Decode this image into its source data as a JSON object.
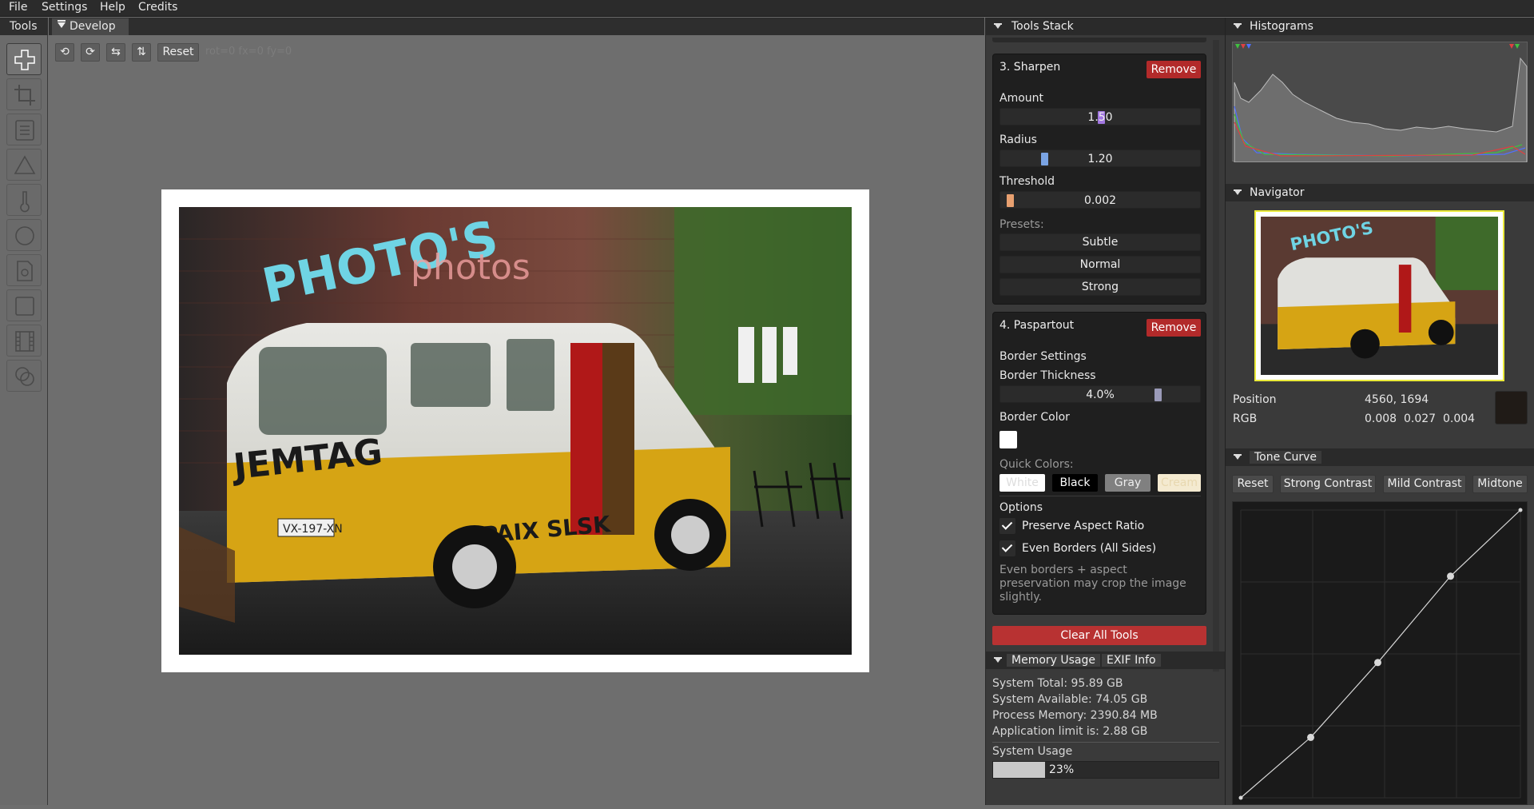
{
  "menu": {
    "file": "File",
    "settings": "Settings",
    "help": "Help",
    "credits": "Credits"
  },
  "tools_panel": {
    "title": "Tools",
    "icons": [
      "move-icon",
      "crop-icon",
      "list-icon",
      "triangle-icon",
      "thermometer-icon",
      "circle-icon",
      "document-icon",
      "square-icon",
      "film-icon",
      "overlap-circles-icon"
    ]
  },
  "develop": {
    "tab": "Develop",
    "buttons": {
      "rotate_left": "⟲",
      "rotate_right": "⟳",
      "flip_h": "⇆",
      "flip_v": "⇅",
      "reset": "Reset"
    },
    "readout": "rot=0 fx=0 fy=0"
  },
  "tools_stack": {
    "title": "Tools Stack",
    "sharpen": {
      "title": "3. Sharpen",
      "remove": "Remove",
      "amount_label": "Amount",
      "amount_value": "1.50",
      "amount_fraction": 0.5,
      "radius_label": "Radius",
      "radius_value": "1.20",
      "radius_fraction": 0.2,
      "threshold_label": "Threshold",
      "threshold_value": "0.002",
      "threshold_fraction": 0.02,
      "presets_label": "Presets:",
      "presets": [
        "Subtle",
        "Normal",
        "Strong"
      ]
    },
    "paspartout": {
      "title": "4. Paspartout",
      "remove": "Remove",
      "border_settings": "Border Settings",
      "thickness_label": "Border Thickness",
      "thickness_value": "4.0%",
      "thickness_fraction": 0.8,
      "color_label": "Border Color",
      "border_color": "#ffffff",
      "quick_colors_label": "Quick Colors:",
      "quick_colors": [
        {
          "label": "White",
          "bg": "#ffffff",
          "fg": "#dddddd"
        },
        {
          "label": "Black",
          "bg": "#000000",
          "fg": "#ffffff"
        },
        {
          "label": "Gray",
          "bg": "#808080",
          "fg": "#eeeeee"
        },
        {
          "label": "Cream",
          "bg": "#f4ead0",
          "fg": "#e8d8b0"
        }
      ],
      "options_label": "Options",
      "preserve_aspect": "Preserve Aspect Ratio",
      "even_borders": "Even Borders (All Sides)",
      "note": "Even borders + aspect preservation may crop the image slightly."
    },
    "clear_all": "Clear All Tools"
  },
  "memory": {
    "tab_memory": "Memory Usage",
    "tab_exif": "EXIF Info",
    "system_total": "System Total: 95.89 GB",
    "system_available": "System Available: 74.05 GB",
    "process_memory": "Process Memory: 2390.84 MB",
    "app_limit": "Application limit is: 2.88 GB",
    "usage_label": "System Usage",
    "usage_text": "23%",
    "usage_fraction": 0.23
  },
  "histograms": {
    "title": "Histograms"
  },
  "navigator": {
    "title": "Navigator",
    "position_label": "Position",
    "position_value": "4560, 1694",
    "rgb_label": "RGB",
    "rgb_value": "0.008  0.027  0.004"
  },
  "tone_curve": {
    "title": "Tone Curve",
    "buttons": [
      "Reset",
      "Strong Contrast",
      "Mild Contrast",
      "Midtone"
    ],
    "points": [
      [
        0,
        0
      ],
      [
        0.25,
        0.21
      ],
      [
        0.49,
        0.47
      ],
      [
        0.75,
        0.77
      ],
      [
        1,
        1
      ]
    ]
  }
}
